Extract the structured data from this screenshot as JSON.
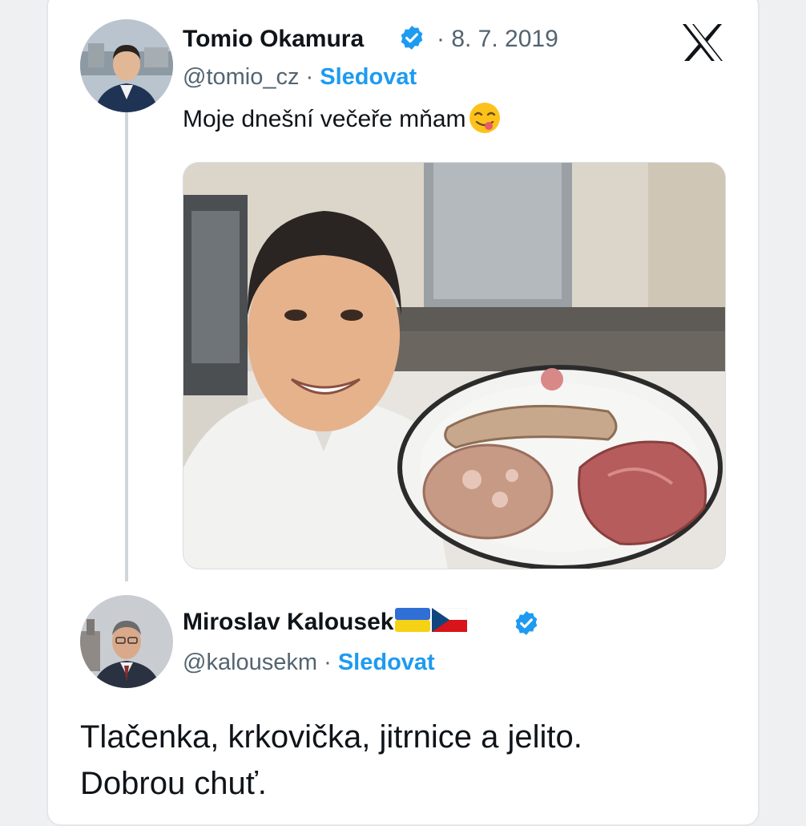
{
  "tweet": {
    "author_name": "Tomio Okamura",
    "date": "· 8. 7. 2019",
    "handle": "@tomio_cz",
    "separator": " · ",
    "follow_label": "Sledovat",
    "text": "Moje dnešní večeře mňam",
    "emoji": "face-savoring-food-icon",
    "verified_color": "#1d9bf0"
  },
  "reply": {
    "author_name": "Miroslav Kalousek",
    "flags": [
      "ukraine-flag-icon",
      "czech-flag-icon"
    ],
    "handle": "@kalousekm",
    "separator": " · ",
    "follow_label": "Sledovat",
    "text_line1": "Tlačenka, krkovička, jitrnice a jelito.",
    "text_line2": "Dobrou chuť."
  },
  "brand": {
    "logo": "x-logo-icon"
  }
}
